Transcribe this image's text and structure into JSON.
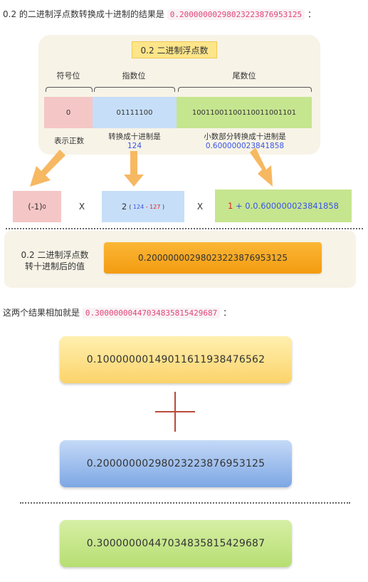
{
  "intro": {
    "text": "0.2 的二进制浮点数转换成十进制的结果是",
    "value": "0.20000000298023223876953125",
    "suffix": "："
  },
  "diagram": {
    "title": "0.2 二进制浮点数",
    "headers": {
      "sign": "符号位",
      "exponent": "指数位",
      "mantissa": "尾数位"
    },
    "bits": {
      "sign": "0",
      "exponent": "01111100",
      "mantissa": "10011001100110011001101"
    },
    "descriptions": {
      "sign": "表示正数",
      "exponent_label": "转换成十进制是",
      "exponent_value": "124",
      "mantissa_label": "小数部分转换成十进制是",
      "mantissa_value": "0.600000023841858"
    },
    "formula": {
      "sign_base": "(-1)",
      "sign_exp": "0",
      "times1": "X",
      "exp_base": "2",
      "exp_open": "(",
      "exp_a": "124",
      "exp_minus": "-",
      "exp_b": "127",
      "exp_close": ")",
      "times2": "X",
      "mant_one": "1",
      "mant_rest": "+ 0.0.600000023841858"
    },
    "result_label_line1": "0.2 二进制浮点数",
    "result_label_line2": "转十进制后的值",
    "result_value": "0.20000000298023223876953125"
  },
  "sum_intro": {
    "text": "这两个结果相加就是",
    "value": "0.30000000447034835815429687",
    "suffix": "："
  },
  "sum": {
    "a": "0.10000000149011611938476562",
    "b": "0.20000000298023223876953125",
    "result": "0.30000000447034835815429687"
  },
  "colors": {
    "yellow": "#fde58a",
    "pink": "#f5c6c6",
    "blue": "#c7def8",
    "green": "#c6e58f",
    "orange": "#f7a51c",
    "arrow": "#f7b862",
    "plus": "#b84a3a"
  }
}
